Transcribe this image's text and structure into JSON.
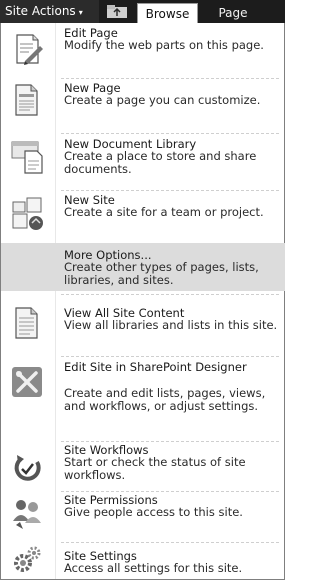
{
  "ribbon": {
    "site_actions_label": "Site Actions",
    "site_actions_caret": "▾",
    "folder_icon": "folder-up-icon",
    "tabs": [
      {
        "label": "Browse"
      },
      {
        "label": "Page"
      }
    ]
  },
  "menu": {
    "items": [
      {
        "title": "Edit Page",
        "description": "Modify the web parts on this page.",
        "icon": "edit-page-icon"
      },
      {
        "title": "New Page",
        "description": "Create a page you can customize.",
        "icon": "new-page-icon"
      },
      {
        "title": "New Document Library",
        "description": "Create a place to store and share documents.",
        "icon": "document-library-icon"
      },
      {
        "title": "New Site",
        "description": "Create a site for a team or project.",
        "icon": "new-site-icon"
      },
      {
        "title": "More Options...",
        "description": "Create other types of pages, lists, libraries, and sites.",
        "icon": "",
        "highlighted": true
      },
      {
        "title": "View All Site Content",
        "description": "View all libraries and lists in this site.",
        "icon": "site-content-icon"
      },
      {
        "title": "Edit Site in SharePoint Designer",
        "description": "Create and edit lists, pages, views, and workflows, or adjust settings.",
        "icon": "sharepoint-designer-icon"
      },
      {
        "title": "Site Workflows",
        "description": "Start or check the status of site workflows.",
        "icon": "workflow-icon"
      },
      {
        "title": "Site Permissions",
        "description": "Give people access to this site.",
        "icon": "permissions-icon"
      },
      {
        "title": "Site Settings",
        "description": "Access all settings for this site.",
        "icon": "settings-gear-icon"
      }
    ]
  }
}
